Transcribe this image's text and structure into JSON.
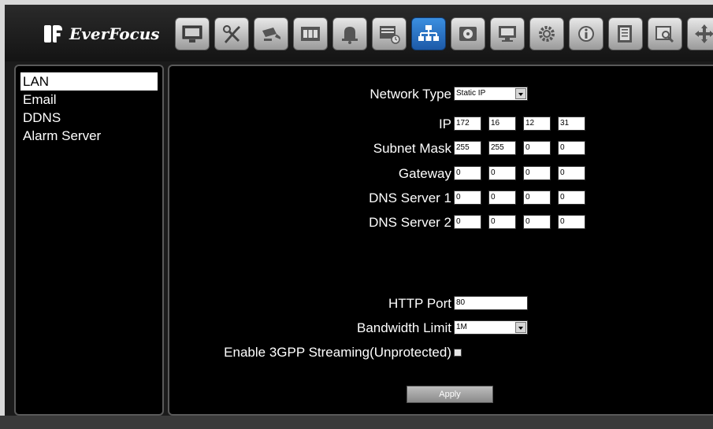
{
  "brand": {
    "name": "EverFocus"
  },
  "toolbar": {
    "icons": [
      "display-icon",
      "tools-icon",
      "camera-icon",
      "record-icon",
      "alarm-icon",
      "schedule-icon",
      "network-icon",
      "disk-icon",
      "monitor-icon",
      "settings-icon",
      "info-icon",
      "log-icon",
      "search-icon",
      "ptz-icon"
    ],
    "active": "network-icon"
  },
  "sidebar": {
    "items": [
      {
        "label": "LAN",
        "selected": true
      },
      {
        "label": "Email",
        "selected": false
      },
      {
        "label": "DDNS",
        "selected": false
      },
      {
        "label": "Alarm Server",
        "selected": false
      }
    ]
  },
  "form": {
    "network_type": {
      "label": "Network Type",
      "value": "Static IP"
    },
    "ip": {
      "label": "IP",
      "octets": [
        "172",
        "16",
        "12",
        "31"
      ]
    },
    "subnet": {
      "label": "Subnet Mask",
      "octets": [
        "255",
        "255",
        "0",
        "0"
      ]
    },
    "gateway": {
      "label": "Gateway",
      "octets": [
        "0",
        "0",
        "0",
        "0"
      ]
    },
    "dns1": {
      "label": "DNS Server 1",
      "octets": [
        "0",
        "0",
        "0",
        "0"
      ]
    },
    "dns2": {
      "label": "DNS Server 2",
      "octets": [
        "0",
        "0",
        "0",
        "0"
      ]
    },
    "http_port": {
      "label": "HTTP Port",
      "value": "80"
    },
    "bandwidth": {
      "label": "Bandwidth Limit",
      "value": "1M"
    },
    "streaming": {
      "label": "Enable 3GPP Streaming(Unprotected)",
      "checked": false
    },
    "apply_label": "Apply"
  },
  "colors": {
    "active_tool": "#2a74c8",
    "background": "#000000",
    "text": "#ffffff"
  }
}
